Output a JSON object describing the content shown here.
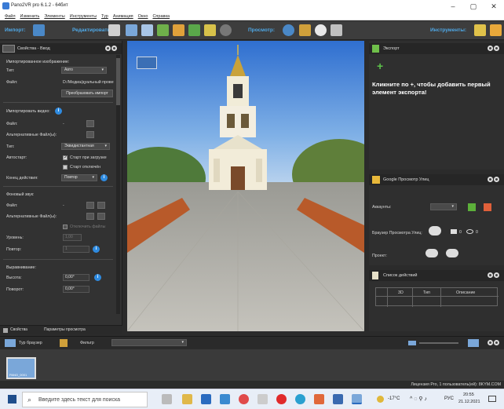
{
  "window": {
    "title": "Pano2VR pro 6.1.2 - 64бит",
    "minimize": "–",
    "maximize": "▢",
    "close": "✕"
  },
  "menu": [
    "Файл",
    "Изменить",
    "Элементы",
    "Инструменты",
    "Тур",
    "Анимация",
    "Окно",
    "Справка"
  ],
  "toolbar": {
    "import_label": "Импорт:",
    "edit_label": "Редактировать:",
    "view_label": "Просмотр:",
    "tools_label": "Инструменты:"
  },
  "left_panel": {
    "title": "Свойства - Ввод",
    "imported_image": "Импортированное изображение:",
    "type_label": "Тип:",
    "type_value": "Авто",
    "file_label": "Файл:",
    "file_value": "D:/Медиа/дуальный прове",
    "convert_button": "Преобразовать импорт",
    "imported_video": "Импортировать видео:",
    "video_file_label": "Файл:",
    "video_file_value": "-",
    "alt_files_label": "Альтернативные Файл(ы):",
    "video_type_label": "Тип:",
    "video_type_value": "Эквидистантная",
    "autostart_label": "Автостарт:",
    "autostart_check": "Старт при загрузке",
    "start_off": "Старт отключён",
    "end_action_label": "Конец действия:",
    "end_action_value": "Повтор",
    "bg_sound": "Фоновый звук:",
    "sound_file_label": "Файл:",
    "sound_file_value": "-",
    "sound_alt_label": "Альтернативные Файл(ы):",
    "unlock_files": "Отключить файлы",
    "level_label": "Уровень:",
    "level_value": "1,00",
    "repeat_label": "Повтор:",
    "repeat_value": "1",
    "alignment": "Выравнивание:",
    "height_label": "Высота:",
    "height_value": "0,00°",
    "rotation_label": "Поворот:",
    "rotation_value": "0,00°",
    "tab_properties": "Свойства",
    "tab_view_params": "Параметры просмотра"
  },
  "export_panel": {
    "title": "Экспорт",
    "add_hint": "Кликните по +, чтобы добавить первый элемент экспорта!"
  },
  "google_panel": {
    "title": "Google Просмотр Улиц",
    "accounts_label": "Аккаунты:",
    "browser_label": "Браузер Просмотра Улиц:",
    "count_a": "0",
    "count_b": "0",
    "project_label": "Проект:"
  },
  "actions_panel": {
    "title": "Список действий",
    "columns": [
      "3D",
      "Тип",
      "Описание"
    ]
  },
  "tour": {
    "title": "Тур браузер",
    "filter_label": "Фильтр",
    "thumb_label": "PANO_0001"
  },
  "status": {
    "license": "Лицензия Pro, 1 пользователь(ей): 8KYM.COM"
  },
  "taskbar": {
    "search_placeholder": "Введите здесь текст для поиска",
    "weather": "-17°C",
    "lang": "РУС",
    "time": "20:55",
    "date": "21.12.2021"
  },
  "colors": {
    "accent_blue": "#4fa8e6",
    "panel_bg": "#323232",
    "info_blue": "#2f8be0"
  }
}
